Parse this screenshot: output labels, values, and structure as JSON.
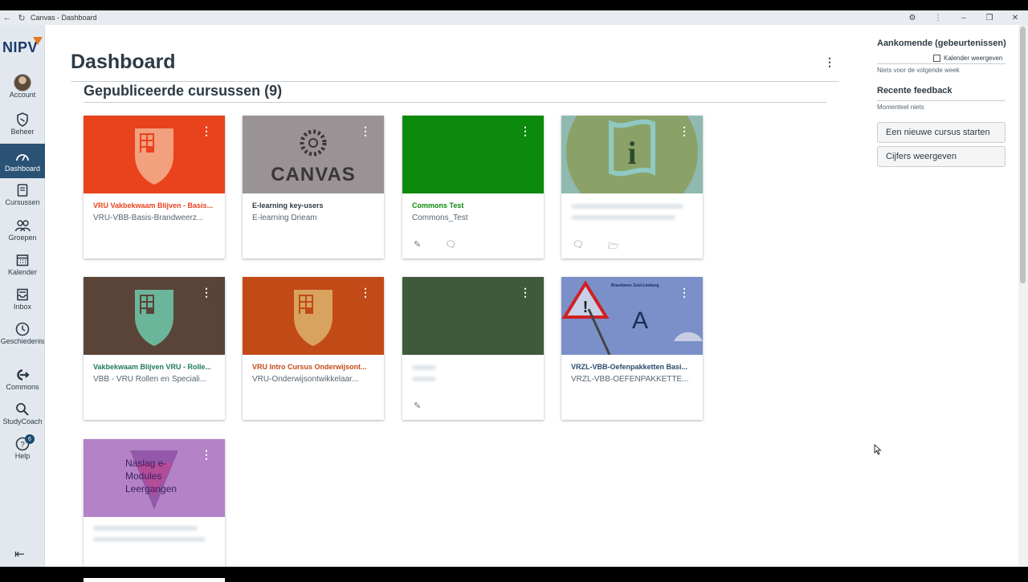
{
  "window": {
    "title": "Canvas - Dashboard"
  },
  "nav": {
    "logo": "NIPV",
    "items": [
      {
        "label": "Account",
        "icon": "avatar"
      },
      {
        "label": "Beheer",
        "icon": "shield-icon"
      },
      {
        "label": "Dashboard",
        "icon": "gauge-icon"
      },
      {
        "label": "Cursussen",
        "icon": "book-icon"
      },
      {
        "label": "Groepen",
        "icon": "users-icon"
      },
      {
        "label": "Kalender",
        "icon": "calendar-icon"
      },
      {
        "label": "Inbox",
        "icon": "inbox-icon"
      },
      {
        "label": "Geschiedenis",
        "icon": "clock-icon"
      },
      {
        "label": "Commons",
        "icon": "commons-icon"
      },
      {
        "label": "StudyCoach",
        "icon": "search-icon"
      },
      {
        "label": "Help",
        "icon": "help-icon",
        "badge": "6"
      }
    ]
  },
  "main": {
    "title": "Dashboard",
    "section": "Gepubliceerde cursussen (9)"
  },
  "cards": [
    {
      "title": "VRU Vakbekwaam Blijven - Basis...",
      "subtitle": "VRU-VBB-Basis-Brandweerz...",
      "color": "#e8431c",
      "titleColor": "#e8431c"
    },
    {
      "title": "E-learning key-users",
      "subtitle": "E-learning Drieam",
      "color": "#9a9396",
      "titleColor": "#2d3b45",
      "heroText": "CANVAS"
    },
    {
      "title": "Commons Test",
      "subtitle": "Commons_Test",
      "color": "#0b8a0b",
      "titleColor": "#0b8a0b"
    },
    {
      "title": "",
      "subtitle": "",
      "color": "#8fb9b1",
      "titleColor": "#2d3b45"
    },
    {
      "title": "Vakbekwaam Blijven VRU - Rolle...",
      "subtitle": "VBB - VRU Rollen en Speciali...",
      "color": "#5a4438",
      "titleColor": "#1f7a58"
    },
    {
      "title": "VRU Intro Cursus Onderwijsont...",
      "subtitle": "VRU-Onderwijsontwikkelaar...",
      "color": "#c24a17",
      "titleColor": "#c24a17"
    },
    {
      "title": "",
      "subtitle": "",
      "color": "#3f5a3a",
      "titleColor": "#2d3b45"
    },
    {
      "title": "VRZL-VBB-Oefenpakketten Basi...",
      "subtitle": "VRZL-VBB-OEFENPAKKETTE...",
      "color": "#7b8fc9",
      "titleColor": "#2a4b6d",
      "heroText": "A",
      "heroSmall": "Brandweer Zuid-Limburg"
    },
    {
      "title": "",
      "subtitle": "",
      "color": "#b483c7",
      "titleColor": "#2d3b45",
      "heroText": "Naslag e-Modules Leergangen"
    }
  ],
  "sidebar": {
    "upcoming_title": "Aankomende (gebeurtenissen)",
    "calendar_link": "Kalender weergeven",
    "upcoming_text": "Niets voor de volgende week",
    "feedback_title": "Recente feedback",
    "feedback_text": "Momenteel niets",
    "btn_new_course": "Een nieuwe cursus starten",
    "btn_grades": "Cijfers weergeven"
  }
}
